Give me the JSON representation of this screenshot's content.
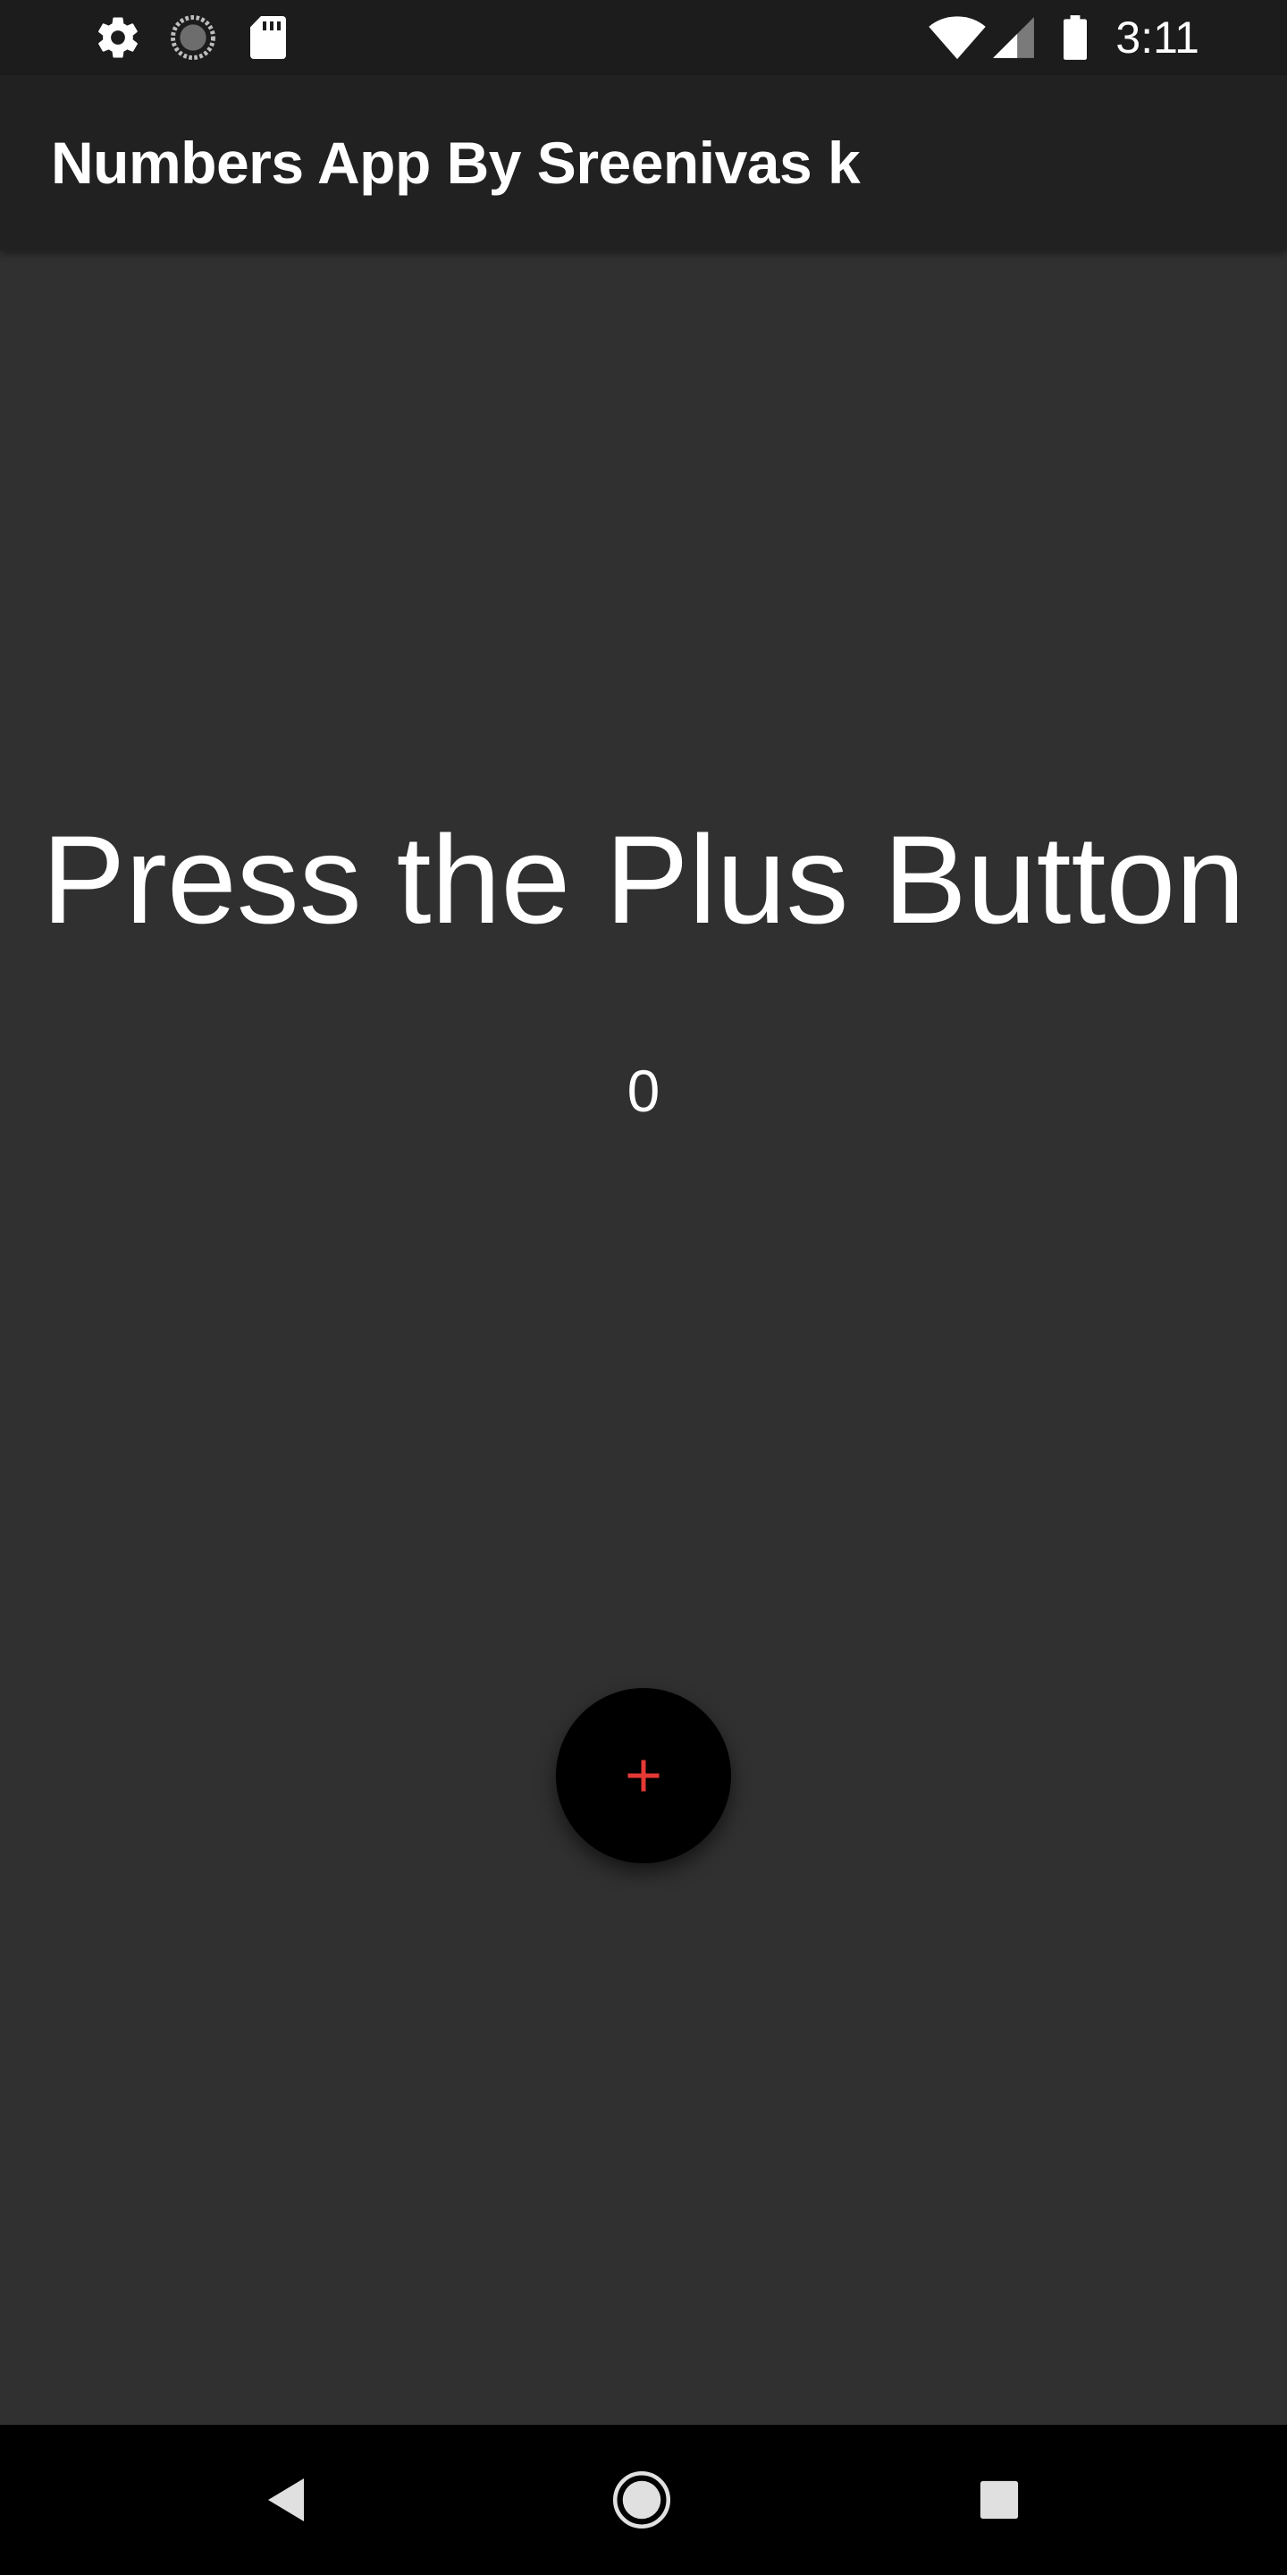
{
  "status_bar": {
    "time": "3:11",
    "icons": [
      "gear-icon",
      "sync-icon",
      "sd-card-icon",
      "wifi-icon",
      "cell-signal-icon",
      "battery-icon"
    ]
  },
  "app_bar": {
    "title": "Numbers App By Sreenivas k"
  },
  "main": {
    "headline": "Press the Plus Button",
    "counter_value": "0"
  },
  "fab": {
    "icon": "plus-icon",
    "icon_color": "#e53935",
    "background": "#000000"
  },
  "nav_bar": {
    "buttons": [
      "back-icon",
      "home-icon",
      "recents-icon"
    ]
  },
  "colors": {
    "background": "#303030",
    "app_bar": "#212121",
    "status_bar": "#1c1c1c",
    "text": "#ffffff"
  }
}
